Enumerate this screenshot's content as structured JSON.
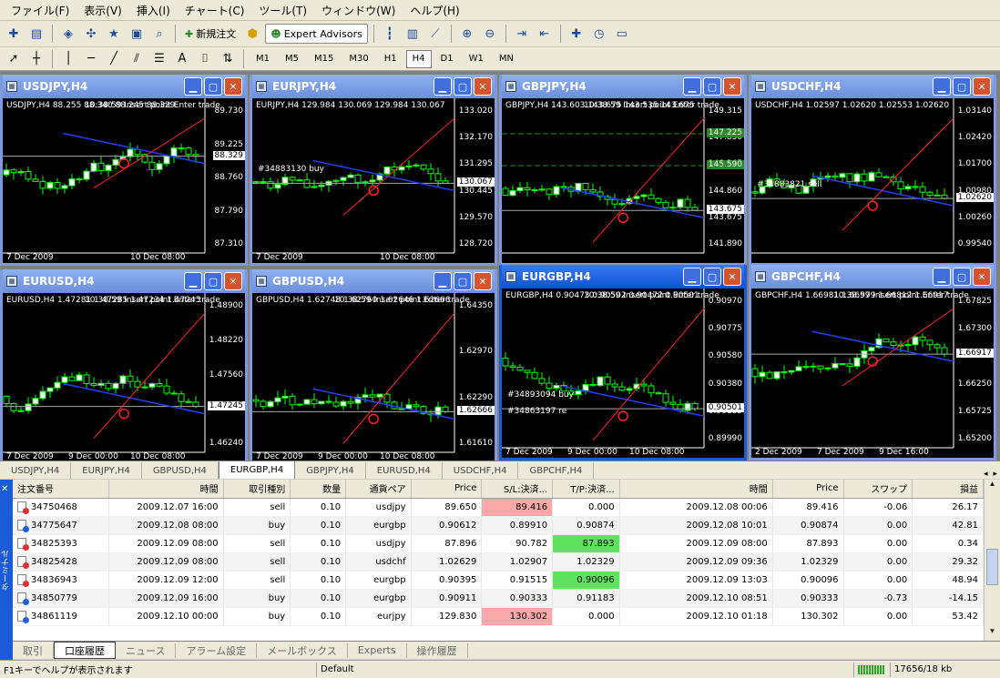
{
  "menu": [
    "ファイル(F)",
    "表示(V)",
    "挿入(I)",
    "チャート(C)",
    "ツール(T)",
    "ウィンドウ(W)",
    "ヘルプ(H)"
  ],
  "toolbar": {
    "new_order": "新規注文",
    "expert_advisors": "Expert Advisors",
    "timeframes": [
      "M1",
      "M5",
      "M15",
      "M30",
      "H1",
      "H4",
      "D1",
      "W1",
      "MN"
    ],
    "active_timeframe": "H4"
  },
  "charts": [
    {
      "title": "USDJPY,H4",
      "info": "USDJPY,H4  88.255 88.340 88.245 88.329",
      "prices": [
        "89.730",
        "89.225",
        "88.760",
        "87.790",
        "87.310"
      ],
      "current": "88.329",
      "dates": [
        "7 Dec 2009",
        "",
        "10 Dec 08:00"
      ],
      "overlay": "10:38:59 Insert point Enter trade"
    },
    {
      "title": "EURJPY,H4",
      "info": "EURJPY,H4  129.984 130.069 129.984 130.067",
      "prices": [
        "133.020",
        "132.170",
        "131.295",
        "130.445",
        "129.570",
        "128.720"
      ],
      "current": "130.067",
      "dates": [
        "7 Dec 2009",
        "",
        "10 Dec 08:00"
      ],
      "orders": [
        "#34883130 buy"
      ]
    },
    {
      "title": "GBPJPY,H4",
      "info": "GBPJPY,H4  143.603 143.675 143.535 143.675",
      "prices": [
        "149.315",
        "147.830",
        "146.345",
        "144.860",
        "143.675",
        "141.890"
      ],
      "current": "143.675",
      "levels": [
        "147.225",
        "145.590"
      ],
      "dates": [],
      "overlay": "10:38:59 Insert point Enter trade"
    },
    {
      "title": "USDCHF,H4",
      "info": "USDCHF,H4  1.02597 1.02620 1.02553 1.02620",
      "prices": [
        "1.03140",
        "1.02420",
        "1.01700",
        "1.00980",
        "1.00260",
        "0.99540"
      ],
      "current": "1.02620",
      "orders": [
        "#34883821 sell"
      ],
      "dates": []
    },
    {
      "title": "EURUSD,H4",
      "info": "EURUSD,H4  1.47281 1.47285 1.47234 1.47245",
      "prices": [
        "1.48900",
        "1.48220",
        "1.47560",
        "1.46900",
        "1.46240"
      ],
      "current": "1.47245",
      "dates": [
        "7 Dec 2009",
        "9 Dec 00:00",
        "10 Dec 08:00"
      ],
      "overlay": "10:38:59 Insert point Enter trade"
    },
    {
      "title": "GBPUSD,H4",
      "info": "GBPUSD,H4  1.62748 1.62760 1.62646 1.62666",
      "prices": [
        "1.64350",
        "1.62970",
        "1.62290",
        "1.61610"
      ],
      "current": "1.62666",
      "dates": [
        "7 Dec 2009",
        "9 Dec 00:00",
        "10 Dec 08:00"
      ],
      "overlay": "10:38:59 Insert point Enter trade"
    },
    {
      "title": "EURGBP,H4",
      "info": "EURGBP,H4  0.90473 0.90502 0.90472 0.90501",
      "prices": [
        "0.90970",
        "0.90775",
        "0.90580",
        "0.90380",
        "0.90185",
        "0.89990"
      ],
      "current": "0.90501",
      "orders": [
        "#34893094 buy",
        "#34863197 re"
      ],
      "dates": [
        "7 Dec 2009",
        "9 Dec 00:00",
        "10 Dec 08:00"
      ],
      "overlay": "10:38:59 Insert point Enter trade"
    },
    {
      "title": "GBPCHF,H4",
      "info": "GBPCHF,H4  1.66981 1.66979 1.66812 1.66917",
      "prices": [
        "1.67825",
        "1.67300",
        "1.66775",
        "1.66250",
        "1.65725",
        "1.65200"
      ],
      "current": "1.66917",
      "dates": [
        "2 Dec 2009",
        "7 Dec 2009",
        "9 Dec 16:00"
      ],
      "overlay": "10:38:59 Insert point Enter trade"
    }
  ],
  "chart_tabs": [
    "USDJPY,H4",
    "EURJPY,H4",
    "GBPUSD,H4",
    "EURGBP,H4",
    "GBPJPY,H4",
    "EURUSD,H4",
    "USDCHF,H4",
    "GBPCHF,H4"
  ],
  "active_chart_tab": "EURGBP,H4",
  "terminal": {
    "side_label": "ターミナル",
    "columns": [
      "注文番号",
      "時間",
      "取引種別",
      "数量",
      "通貨ペア",
      "Price",
      "S/L:決済...",
      "T/P:決済...",
      "時間",
      "Price",
      "スワップ",
      "損益"
    ],
    "rows": [
      {
        "ticket": "34750468",
        "time": "2009.12.07 16:00",
        "type": "sell",
        "size": "0.10",
        "symbol": "usdjpy",
        "price": "89.650",
        "sl": "89.416",
        "tp": "0.000",
        "ctime": "2009.12.08 00:06",
        "cprice": "89.416",
        "swap": "-0.06",
        "profit": "26.17"
      },
      {
        "ticket": "34775647",
        "time": "2009.12.08 08:00",
        "type": "buy",
        "size": "0.10",
        "symbol": "eurgbp",
        "price": "0.90612",
        "sl": "0.89910",
        "tp": "0.90874",
        "ctime": "2009.12.08 10:01",
        "cprice": "0.90874",
        "swap": "0.00",
        "profit": "42.81"
      },
      {
        "ticket": "34825393",
        "time": "2009.12.09 08:00",
        "type": "sell",
        "size": "0.10",
        "symbol": "usdjpy",
        "price": "87.896",
        "sl": "90.782",
        "tp": "87.893",
        "ctime": "2009.12.09 08:00",
        "cprice": "87.893",
        "swap": "0.00",
        "profit": "0.34"
      },
      {
        "ticket": "34825428",
        "time": "2009.12.09 08:00",
        "type": "sell",
        "size": "0.10",
        "symbol": "usdchf",
        "price": "1.02629",
        "sl": "1.02907",
        "tp": "1.02329",
        "ctime": "2009.12.09 09:36",
        "cprice": "1.02329",
        "swap": "0.00",
        "profit": "29.32"
      },
      {
        "ticket": "34836943",
        "time": "2009.12.09 12:00",
        "type": "sell",
        "size": "0.10",
        "symbol": "eurgbp",
        "price": "0.90395",
        "sl": "0.91515",
        "tp": "0.90096",
        "ctime": "2009.12.09 13:03",
        "cprice": "0.90096",
        "swap": "0.00",
        "profit": "48.94"
      },
      {
        "ticket": "34850779",
        "time": "2009.12.09 16:00",
        "type": "buy",
        "size": "0.10",
        "symbol": "eurgbp",
        "price": "0.90911",
        "sl": "0.90333",
        "tp": "0.91183",
        "ctime": "2009.12.10 08:51",
        "cprice": "0.90333",
        "swap": "-0.73",
        "profit": "-14.15"
      },
      {
        "ticket": "34861119",
        "time": "2009.12.10 00:00",
        "type": "buy",
        "size": "0.10",
        "symbol": "eurjpy",
        "price": "129.830",
        "sl": "130.302",
        "tp": "0.000",
        "ctime": "2009.12.10 01:18",
        "cprice": "130.302",
        "swap": "0.00",
        "profit": "53.42"
      }
    ],
    "tabs": [
      "取引",
      "口座履歴",
      "ニュース",
      "アラーム設定",
      "メールボックス",
      "Experts",
      "操作履歴"
    ],
    "active_tab": "口座履歴"
  },
  "status": {
    "help": "F1キーでヘルプが表示されます",
    "profile": "Default",
    "traffic": "17656/18 kb"
  }
}
